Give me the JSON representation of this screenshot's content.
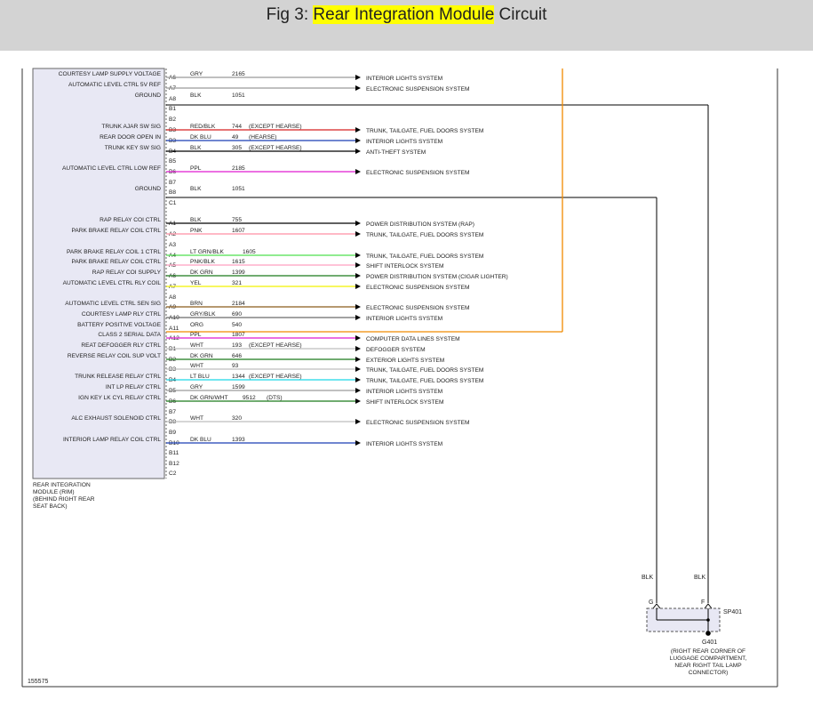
{
  "header": {
    "prefix": "Fig 3: ",
    "highlight": "Rear Integration Module",
    "suffix": " Circuit"
  },
  "module": {
    "name_lines": [
      "REAR INTEGRATION",
      "MODULE (RIM)",
      "(BEHIND RIGHT REAR",
      "SEAT BACK)"
    ]
  },
  "pins": [
    {
      "pin": "A6",
      "label": "COURTESY LAMP SUPPLY VOLTAGE",
      "color_name": "GRY",
      "circuit": "2165",
      "note": "",
      "dest": "INTERIOR LIGHTS SYSTEM",
      "wire": "#9a9a9a",
      "arrow": true
    },
    {
      "pin": "A7",
      "label": "AUTOMATIC LEVEL CTRL 5V REF",
      "color_name": "",
      "circuit": "",
      "note": "",
      "dest": "ELECTRONIC SUSPENSION SYSTEM",
      "wire": "#9a9a9a",
      "arrow": true
    },
    {
      "pin": "A8",
      "label": "GROUND",
      "color_name": "BLK",
      "circuit": "1051",
      "note": "",
      "dest": "",
      "wire": "#000000",
      "arrow": false
    },
    {
      "pin": "B1",
      "label": "",
      "color_name": "",
      "circuit": "",
      "note": "",
      "dest": "",
      "wire": "",
      "arrow": false
    },
    {
      "pin": "B2",
      "label": "",
      "color_name": "",
      "circuit": "",
      "note": "",
      "dest": "",
      "wire": "",
      "arrow": false
    },
    {
      "pin": "B3",
      "label": "TRUNK AJAR SW SIG",
      "color_name": "RED/BLK",
      "circuit": "744",
      "note": "(EXCEPT HEARSE)",
      "dest": "TRUNK, TAILGATE, FUEL DOORS SYSTEM",
      "wire": "#d62020",
      "arrow": true
    },
    {
      "pin": "B3",
      "label": "REAR DOOR OPEN IN",
      "color_name": "DK BLU",
      "circuit": "49",
      "note": "(HEARSE)",
      "dest": "INTERIOR LIGHTS SYSTEM",
      "wire": "#1a3fb5",
      "arrow": true
    },
    {
      "pin": "B4",
      "label": "TRUNK KEY SW SIG",
      "color_name": "BLK",
      "circuit": "305",
      "note": "(EXCEPT HEARSE)",
      "dest": "ANTI-THEFT SYSTEM",
      "wire": "#000000",
      "arrow": true
    },
    {
      "pin": "B5",
      "label": "",
      "color_name": "",
      "circuit": "",
      "note": "",
      "dest": "",
      "wire": "",
      "arrow": false
    },
    {
      "pin": "B6",
      "label": "AUTOMATIC LEVEL CTRL LOW REF",
      "color_name": "PPL",
      "circuit": "2185",
      "note": "",
      "dest": "ELECTRONIC SUSPENSION SYSTEM",
      "wire": "#e01ad0",
      "arrow": true
    },
    {
      "pin": "B7",
      "label": "",
      "color_name": "",
      "circuit": "",
      "note": "",
      "dest": "",
      "wire": "",
      "arrow": false
    },
    {
      "pin": "B8",
      "label": "GROUND",
      "color_name": "BLK",
      "circuit": "1051",
      "note": "",
      "dest": "",
      "wire": "#000000",
      "arrow": false
    },
    {
      "pin": "C1",
      "label": "",
      "color_name": "",
      "circuit": "",
      "note": "",
      "dest": "",
      "wire": "",
      "arrow": false
    },
    {
      "pin": "A1",
      "label": "RAP RELAY COI CTRL",
      "color_name": "BLK",
      "circuit": "755",
      "note": "",
      "dest": "POWER DISTRIBUTION SYSTEM (RAP)",
      "wire": "#000000",
      "arrow": true
    },
    {
      "pin": "A2",
      "label": "PARK BRAKE RELAY COIL CTRL",
      "color_name": "PNK",
      "circuit": "1607",
      "note": "",
      "dest": "TRUNK, TAILGATE, FUEL DOORS SYSTEM",
      "wire": "#ff8fa3",
      "arrow": true
    },
    {
      "pin": "A3",
      "label": "",
      "color_name": "",
      "circuit": "",
      "note": "",
      "dest": "",
      "wire": "",
      "arrow": false
    },
    {
      "pin": "A4",
      "label": "PARK BRAKE RELAY COIL 1 CTRL",
      "color_name": "LT GRN/BLK",
      "circuit": "1605",
      "note": "",
      "dest": "TRUNK, TAILGATE, FUEL DOORS SYSTEM",
      "wire": "#4ee04e",
      "arrow": true
    },
    {
      "pin": "A5",
      "label": "PARK BRAKE RELAY COIL CTRL",
      "color_name": "PNK/BLK",
      "circuit": "1615",
      "note": "",
      "dest": "SHIFT INTERLOCK SYSTEM",
      "wire": "#ff9fc0",
      "arrow": true
    },
    {
      "pin": "A6",
      "label": "RAP RELAY COI SUPPLY",
      "color_name": "DK GRN",
      "circuit": "1399",
      "note": "",
      "dest": "POWER DISTRIBUTION SYSTEM (CIGAR LIGHTER)",
      "wire": "#1a7a1a",
      "arrow": true
    },
    {
      "pin": "A7",
      "label": "AUTOMATIC LEVEL CTRL RLY COIL",
      "color_name": "YEL",
      "circuit": "321",
      "note": "",
      "dest": "ELECTRONIC SUSPENSION SYSTEM",
      "wire": "#f2f200",
      "arrow": true
    },
    {
      "pin": "A8",
      "label": "",
      "color_name": "",
      "circuit": "",
      "note": "",
      "dest": "",
      "wire": "",
      "arrow": false
    },
    {
      "pin": "A9",
      "label": "AUTOMATIC LEVEL CTRL SEN SIG",
      "color_name": "BRN",
      "circuit": "2184",
      "note": "",
      "dest": "ELECTRONIC SUSPENSION SYSTEM",
      "wire": "#8a5a1a",
      "arrow": true
    },
    {
      "pin": "A10",
      "label": "COURTESY LAMP RLY CTRL",
      "color_name": "GRY/BLK",
      "circuit": "690",
      "note": "",
      "dest": "INTERIOR LIGHTS SYSTEM",
      "wire": "#6a6a6a",
      "arrow": true
    },
    {
      "pin": "A11",
      "label": "BATTERY POSITIVE VOLTAGE",
      "color_name": "ORG",
      "circuit": "540",
      "note": "",
      "dest": "",
      "wire": "#f08a00",
      "arrow": false
    },
    {
      "pin": "A12",
      "label": "CLASS 2 SERIAL DATA",
      "color_name": "PPL",
      "circuit": "1807",
      "note": "",
      "dest": "COMPUTER DATA LINES SYSTEM",
      "wire": "#e01ad0",
      "arrow": true
    },
    {
      "pin": "B1",
      "label": "REAT DEFOGGER RLY CTRL",
      "color_name": "WHT",
      "circuit": "193",
      "note": "(EXCEPT HEARSE)",
      "dest": "DEFOGGER SYSTEM",
      "wire": "#bdbdbd",
      "arrow": true
    },
    {
      "pin": "B2",
      "label": "REVERSE RELAY COIL SUP VOLT",
      "color_name": "DK GRN",
      "circuit": "646",
      "note": "",
      "dest": "EXTERIOR LIGHTS SYSTEM",
      "wire": "#1a7a1a",
      "arrow": true
    },
    {
      "pin": "B3",
      "label": "",
      "color_name": "WHT",
      "circuit": "93",
      "note": "",
      "dest": "TRUNK, TAILGATE, FUEL DOORS SYSTEM",
      "wire": "#bdbdbd",
      "arrow": true
    },
    {
      "pin": "B4",
      "label": "TRUNK RELEASE RELAY CTRL",
      "color_name": "LT BLU",
      "circuit": "1344",
      "note": "(EXCEPT HEARSE)",
      "dest": "TRUNK, TAILGATE, FUEL DOORS SYSTEM",
      "wire": "#1ad6e6",
      "arrow": true
    },
    {
      "pin": "B5",
      "label": "INT LP RELAY CTRL",
      "color_name": "GRY",
      "circuit": "1599",
      "note": "",
      "dest": "INTERIOR LIGHTS SYSTEM",
      "wire": "#9a9a9a",
      "arrow": true
    },
    {
      "pin": "B6",
      "label": "IGN KEY LK CYL RELAY CTRL",
      "color_name": "DK GRN/WHT",
      "circuit": "9512",
      "note": "(DTS)",
      "dest": "SHIFT INTERLOCK SYSTEM",
      "wire": "#1a7a1a",
      "arrow": true
    },
    {
      "pin": "B7",
      "label": "",
      "color_name": "",
      "circuit": "",
      "note": "",
      "dest": "",
      "wire": "",
      "arrow": false
    },
    {
      "pin": "B8",
      "label": "ALC EXHAUST SOLENOID CTRL",
      "color_name": "WHT",
      "circuit": "320",
      "note": "",
      "dest": "ELECTRONIC SUSPENSION SYSTEM",
      "wire": "#bdbdbd",
      "arrow": true
    },
    {
      "pin": "B9",
      "label": "",
      "color_name": "",
      "circuit": "",
      "note": "",
      "dest": "",
      "wire": "",
      "arrow": false
    },
    {
      "pin": "B10",
      "label": "INTERIOR LAMP RELAY COIL CTRL",
      "color_name": "DK BLU",
      "circuit": "1393",
      "note": "",
      "dest": "INTERIOR LIGHTS SYSTEM",
      "wire": "#1a3fb5",
      "arrow": true
    },
    {
      "pin": "B11",
      "label": "",
      "color_name": "",
      "circuit": "",
      "note": "",
      "dest": "",
      "wire": "",
      "arrow": false
    },
    {
      "pin": "B12",
      "label": "",
      "color_name": "",
      "circuit": "",
      "note": "",
      "dest": "",
      "wire": "",
      "arrow": false
    },
    {
      "pin": "C2",
      "label": "",
      "color_name": "",
      "circuit": "",
      "note": "",
      "dest": "",
      "wire": "",
      "arrow": false
    }
  ],
  "ground": {
    "left_wire_color": "BLK",
    "right_wire_color": "BLK",
    "left_terminal": "G",
    "right_terminal": "F",
    "splice_name": "SP401",
    "ground_name": "G401",
    "location_lines": [
      "(RIGHT REAR CORNER OF",
      "LUGGAGE COMPARTMENT,",
      "NEAR RIGHT TAIL LAMP",
      "CONNECTOR)"
    ]
  },
  "figure_number": "155575"
}
